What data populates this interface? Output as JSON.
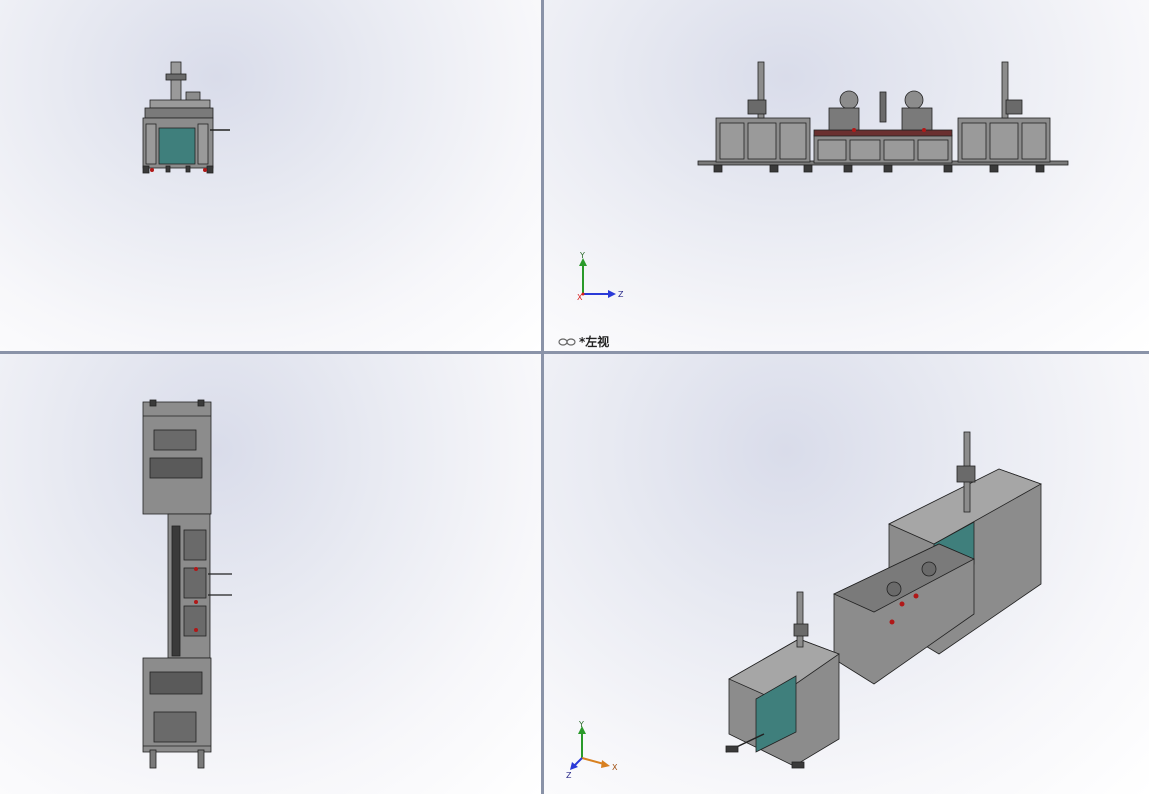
{
  "viewports": {
    "top_left": {},
    "top_right": {
      "view_label": "*左视",
      "triad": {
        "axis_y": "Y",
        "axis_z": "Z",
        "axis_x": "X"
      }
    },
    "bottom_left": {},
    "bottom_right": {
      "triad": {
        "axis_y": "Y",
        "axis_z": "Z",
        "axis_x": "X"
      }
    }
  },
  "colors": {
    "machine_frame": "#8c8c8c",
    "machine_dark": "#3a3a3a",
    "window_teal": "#3f7f7c",
    "accent_red": "#b01818",
    "axis_y": "#2a9a2a",
    "axis_z": "#2a3ad8",
    "axis_x": "#d82020"
  },
  "icons": {
    "view_orientation": "glasses-icon"
  }
}
